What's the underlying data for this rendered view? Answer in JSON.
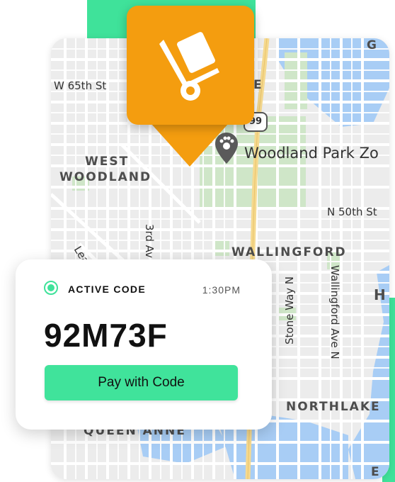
{
  "map": {
    "street_labels": {
      "w65th": "W 65th St",
      "n50th": "N 50th St",
      "third_ave": "3rd Av",
      "leary": "Leary",
      "stone_way": "Stone Way N",
      "wallingford_ave": "Wallingford Ave N"
    },
    "district_labels": {
      "west_woodland": [
        "WEST",
        "WOODLAND"
      ],
      "wallingford": "WALLINGFORD",
      "northlake": "NORTHLAKE",
      "queen_anne": "QUEEN ANNE",
      "partial_top": "GE",
      "partial_top_right": "G",
      "partial_right": "H",
      "partial_bottom_right": "E"
    },
    "park_label": "Woodland Park Zo",
    "route_number": "99",
    "colors": {
      "land": "#ececec",
      "road": "#ffffff",
      "park": "#cfe6c8",
      "water": "#a8cdf5",
      "highway": "#f5d98f"
    }
  },
  "pin": {
    "icon": "hand-truck-icon",
    "color": "#f49d0f"
  },
  "code_card": {
    "status_label": "ACTIVE CODE",
    "time": "1:30PM",
    "code": "92M73F",
    "pay_button_label": "Pay with Code",
    "accent_color": "#40e39b"
  }
}
